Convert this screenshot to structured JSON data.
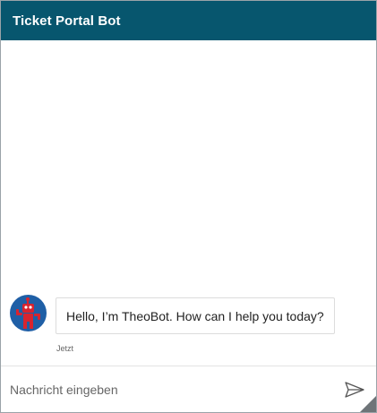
{
  "header": {
    "title": "Ticket Portal Bot"
  },
  "messages": [
    {
      "sender": "bot",
      "avatar_icon": "robot-avatar-icon",
      "text": "Hello, I’m TheoBot. How can I help you today?",
      "timestamp": "Jetzt"
    }
  ],
  "composer": {
    "placeholder": "Nachricht eingeben",
    "value": "",
    "send_icon": "send-icon"
  },
  "colors": {
    "header_bg": "#07566e",
    "avatar_bg": "#1f5fa6",
    "robot": "#d8242f"
  }
}
